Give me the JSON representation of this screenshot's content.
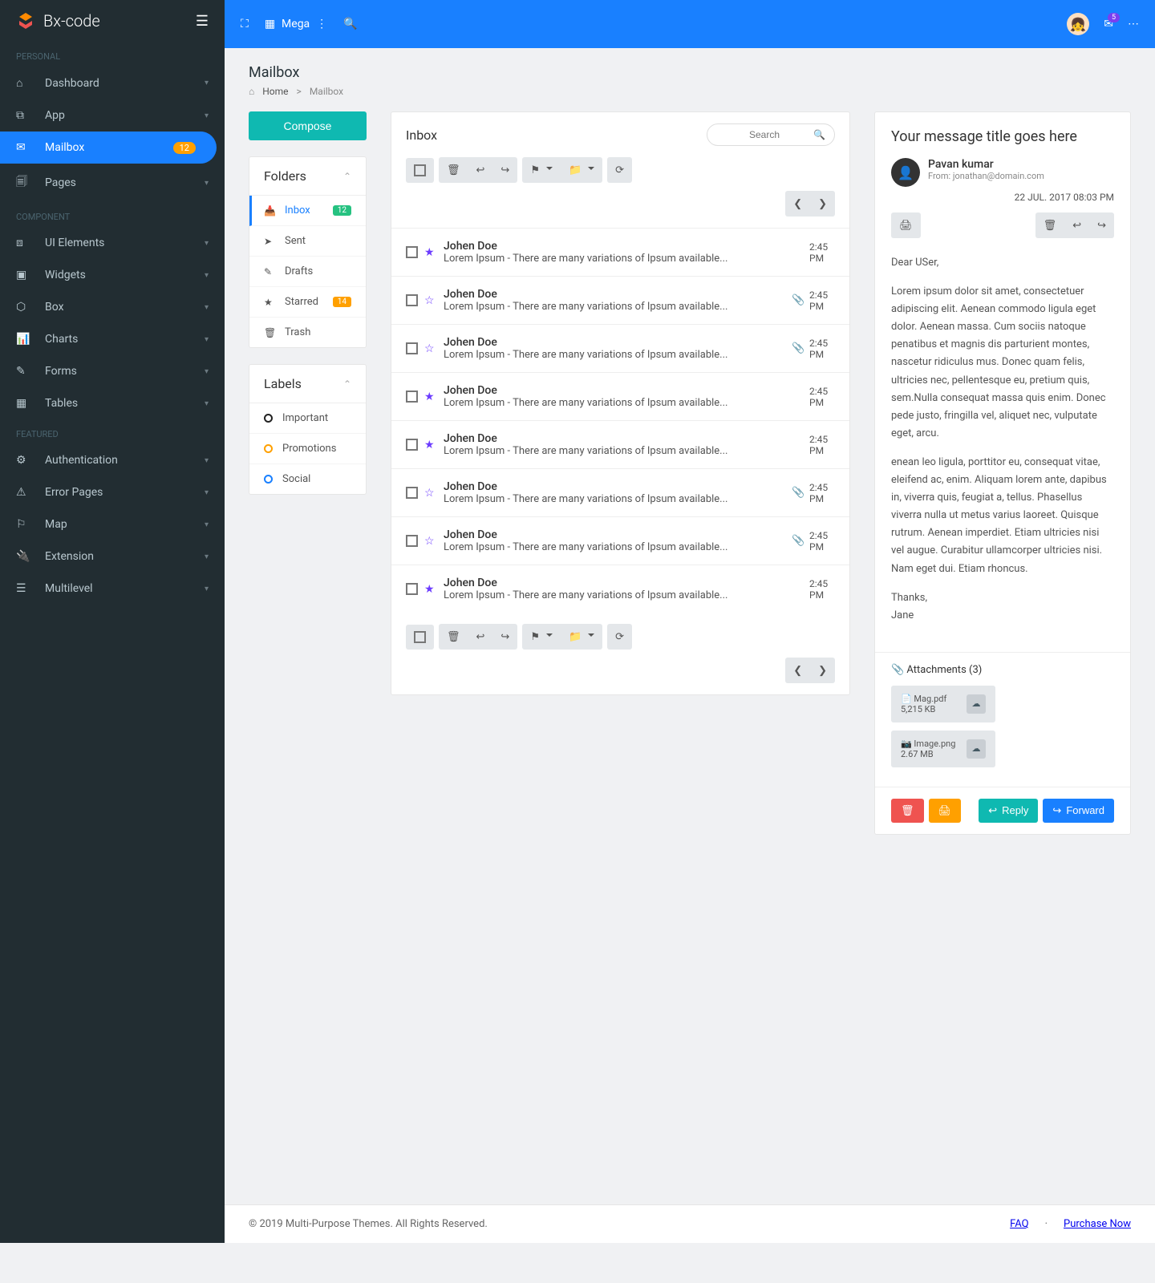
{
  "brand": "Bx-code",
  "topbar": {
    "mega": "Mega",
    "mail_badge": "5"
  },
  "sidebar": {
    "sections": [
      {
        "label": "PERSONAL",
        "items": [
          {
            "icon": "⌂",
            "label": "Dashboard",
            "caret": true
          },
          {
            "icon": "⧉",
            "label": "App",
            "caret": true
          },
          {
            "icon": "✉",
            "label": "Mailbox",
            "active": true,
            "badge": "12"
          },
          {
            "icon": "🗐",
            "label": "Pages",
            "caret": true
          }
        ]
      },
      {
        "label": "COMPONENT",
        "items": [
          {
            "icon": "⧈",
            "label": "UI Elements",
            "caret": true
          },
          {
            "icon": "▣",
            "label": "Widgets",
            "caret": true
          },
          {
            "icon": "⬡",
            "label": "Box",
            "caret": true
          },
          {
            "icon": "📊",
            "label": "Charts",
            "caret": true
          },
          {
            "icon": "✎",
            "label": "Forms",
            "caret": true
          },
          {
            "icon": "▦",
            "label": "Tables",
            "caret": true
          }
        ]
      },
      {
        "label": "FEATURED",
        "items": [
          {
            "icon": "⚙",
            "label": "Authentication",
            "caret": true
          },
          {
            "icon": "⚠",
            "label": "Error Pages",
            "caret": true
          },
          {
            "icon": "⚐",
            "label": "Map",
            "caret": true
          },
          {
            "icon": "🔌",
            "label": "Extension",
            "caret": true
          },
          {
            "icon": "☰",
            "label": "Multilevel",
            "caret": true
          }
        ]
      }
    ]
  },
  "page": {
    "title": "Mailbox",
    "breadcrumb_home": "Home",
    "breadcrumb_sep": ">",
    "breadcrumb_current": "Mailbox"
  },
  "compose": "Compose",
  "folders": {
    "title": "Folders",
    "items": [
      {
        "icon": "📥",
        "label": "Inbox",
        "badge": "12",
        "active": true
      },
      {
        "icon": "➤",
        "label": "Sent"
      },
      {
        "icon": "✎",
        "label": "Drafts"
      },
      {
        "icon": "★",
        "label": "Starred",
        "badge": "14",
        "badge_orange": true
      },
      {
        "icon": "🗑",
        "label": "Trash"
      }
    ]
  },
  "labels": {
    "title": "Labels",
    "items": [
      {
        "color": "#222",
        "label": "Important"
      },
      {
        "color": "#ffa000",
        "label": "Promotions"
      },
      {
        "color": "#1980ff",
        "label": "Social"
      }
    ]
  },
  "inbox": {
    "title": "Inbox",
    "search_placeholder": "Search",
    "rows": [
      {
        "star": true,
        "sender": "Johen Doe",
        "snippet": "Lorem Ipsum - There are many variations of Ipsum available...",
        "attach": false,
        "time": "2:45 PM"
      },
      {
        "star": false,
        "sender": "Johen Doe",
        "snippet": "Lorem Ipsum - There are many variations of Ipsum available...",
        "attach": true,
        "time": "2:45 PM"
      },
      {
        "star": false,
        "sender": "Johen Doe",
        "snippet": "Lorem Ipsum - There are many variations of Ipsum available...",
        "attach": true,
        "time": "2:45 PM"
      },
      {
        "star": true,
        "sender": "Johen Doe",
        "snippet": "Lorem Ipsum - There are many variations of Ipsum available...",
        "attach": false,
        "time": "2:45 PM"
      },
      {
        "star": true,
        "sender": "Johen Doe",
        "snippet": "Lorem Ipsum - There are many variations of Ipsum available...",
        "attach": false,
        "time": "2:45 PM"
      },
      {
        "star": false,
        "sender": "Johen Doe",
        "snippet": "Lorem Ipsum - There are many variations of Ipsum available...",
        "attach": true,
        "time": "2:45 PM"
      },
      {
        "star": false,
        "sender": "Johen Doe",
        "snippet": "Lorem Ipsum - There are many variations of Ipsum available...",
        "attach": true,
        "time": "2:45 PM"
      },
      {
        "star": true,
        "sender": "Johen Doe",
        "snippet": "Lorem Ipsum - There are many variations of Ipsum available...",
        "attach": false,
        "time": "2:45 PM"
      }
    ]
  },
  "message": {
    "title": "Your message title goes here",
    "from_name": "Pavan kumar",
    "from_email": "From: jonathan@domain.com",
    "date": "22 JUL. 2017 08:03 PM",
    "greeting": "Dear USer,",
    "p1": "Lorem ipsum dolor sit amet, consectetuer adipiscing elit. Aenean commodo ligula eget dolor. Aenean massa. Cum sociis natoque penatibus et magnis dis parturient montes, nascetur ridiculus mus. Donec quam felis, ultricies nec, pellentesque eu, pretium quis, sem.Nulla consequat massa quis enim. Donec pede justo, fringilla vel, aliquet nec, vulputate eget, arcu.",
    "p2": "enean leo ligula, porttitor eu, consequat vitae, eleifend ac, enim. Aliquam lorem ante, dapibus in, viverra quis, feugiat a, tellus. Phasellus viverra nulla ut metus varius laoreet. Quisque rutrum. Aenean imperdiet. Etiam ultricies nisi vel augue. Curabitur ullamcorper ultricies nisi. Nam eget dui. Etiam rhoncus.",
    "thanks": "Thanks,",
    "sign": "Jane",
    "attachments_title": "Attachments (3)",
    "attachments": [
      {
        "icon": "📄",
        "name": "Mag.pdf",
        "size": "5,215 KB"
      },
      {
        "icon": "📷",
        "name": "Image.png",
        "size": "2.67 MB"
      }
    ],
    "actions": {
      "reply": "Reply",
      "forward": "Forward"
    }
  },
  "footer": {
    "copyright": "© 2019 Multi-Purpose Themes. All Rights Reserved.",
    "faq": "FAQ",
    "purchase": "Purchase Now"
  }
}
